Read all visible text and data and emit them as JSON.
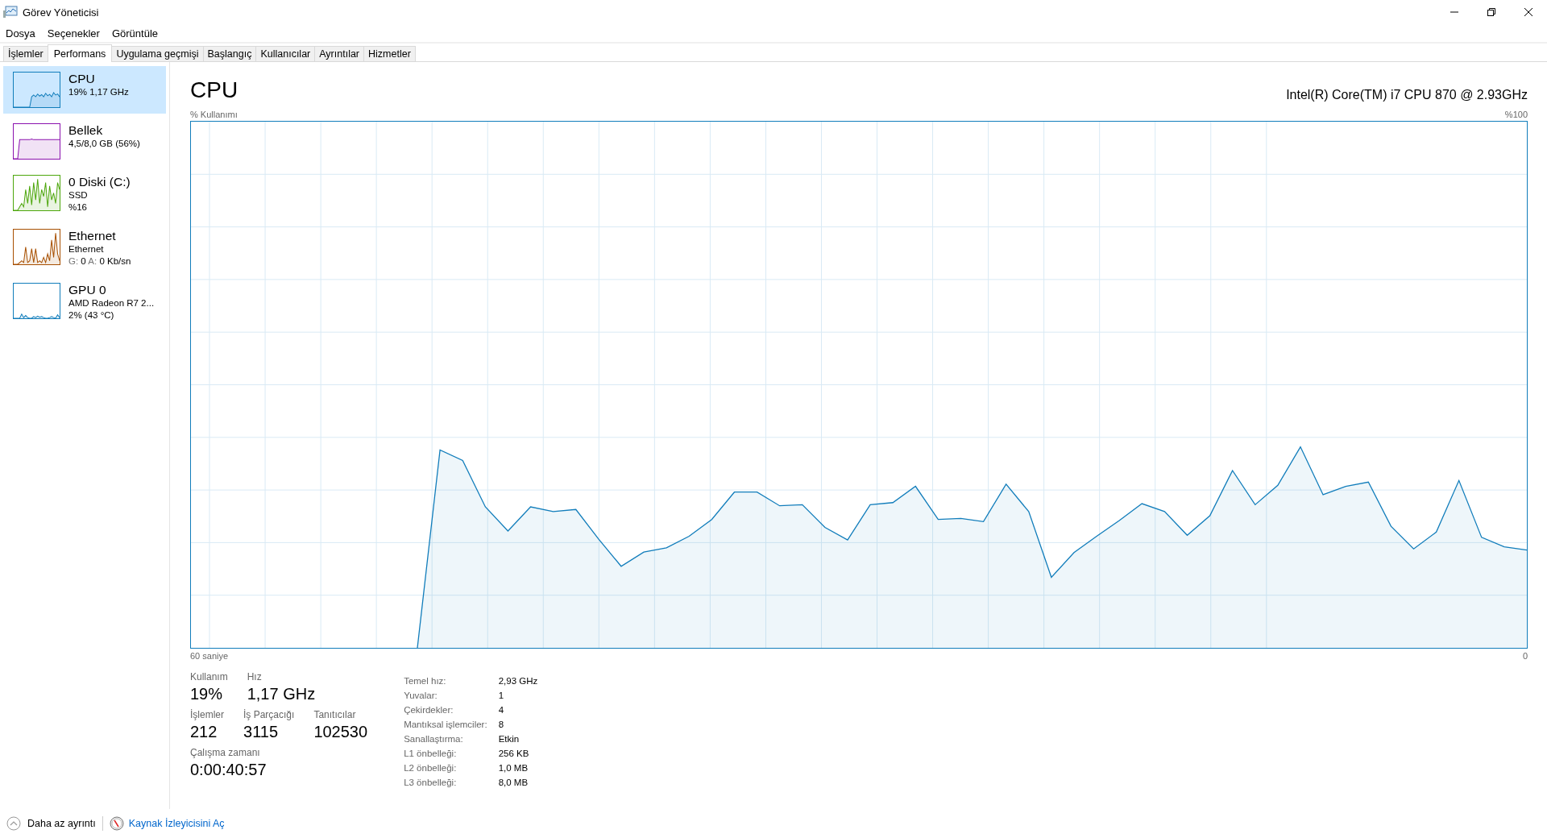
{
  "window": {
    "title": "Görev Yöneticisi"
  },
  "menu": [
    "Dosya",
    "Seçenekler",
    "Görüntüle"
  ],
  "tabs": [
    {
      "label": "İşlemler",
      "selected": false
    },
    {
      "label": "Performans",
      "selected": true
    },
    {
      "label": "Uygulama geçmişi",
      "selected": false
    },
    {
      "label": "Başlangıç",
      "selected": false
    },
    {
      "label": "Kullanıcılar",
      "selected": false
    },
    {
      "label": "Ayrıntılar",
      "selected": false
    },
    {
      "label": "Hizmetler",
      "selected": false
    }
  ],
  "sidebar": {
    "items": [
      {
        "name": "CPU",
        "lines": [
          "19% 1,17 GHz"
        ],
        "color": "#117dbb",
        "selected": true
      },
      {
        "name": "Bellek",
        "lines": [
          "4,5/8,0 GB (56%)"
        ],
        "color": "#8b12ae",
        "selected": false
      },
      {
        "name": "0 Diski (C:)",
        "lines": [
          "SSD",
          "%16"
        ],
        "color": "#4da60c",
        "selected": false
      },
      {
        "name": "Ethernet",
        "lines": [
          "Ethernet"
        ],
        "stats": [
          {
            "label": "G:",
            "value": "0"
          },
          {
            "label": "A:",
            "value": "0 Kb/sn"
          }
        ],
        "color": "#a74f01",
        "selected": false
      },
      {
        "name": "GPU 0",
        "lines": [
          "AMD Radeon R7 2...",
          "2% (43 °C)"
        ],
        "color": "#117dbb",
        "selected": false
      }
    ]
  },
  "panel": {
    "title": "CPU",
    "processor": "Intel(R) Core(TM) i7 CPU 870 @ 2.93GHz",
    "graph": {
      "caption": "% Kullanımı",
      "max_label": "%100",
      "time_label": "60 saniye",
      "end_label": "0"
    },
    "stats": [
      [
        {
          "label": "Kullanım",
          "value": "19%"
        },
        {
          "label": "Hız",
          "value": "1,17 GHz"
        }
      ],
      [
        {
          "label": "İşlemler",
          "value": "212"
        },
        {
          "label": "İş Parçacığı",
          "value": "3115"
        },
        {
          "label": "Tanıtıcılar",
          "value": "102530"
        }
      ],
      [
        {
          "label": "Çalışma zamanı",
          "value": "0:00:40:57"
        }
      ]
    ],
    "details": [
      {
        "label": "Temel hız:",
        "value": "2,93 GHz"
      },
      {
        "label": "Yuvalar:",
        "value": "1"
      },
      {
        "label": "Çekirdekler:",
        "value": "4"
      },
      {
        "label": "Mantıksal işlemciler:",
        "value": "8"
      },
      {
        "label": "Sanallaştırma:",
        "value": "Etkin"
      },
      {
        "label": "L1 önbelleği:",
        "value": "256 KB"
      },
      {
        "label": "L2 önbelleği:",
        "value": "1,0 MB"
      },
      {
        "label": "L3 önbelleği:",
        "value": "8,0 MB"
      }
    ]
  },
  "footer": {
    "collapse": "Daha az ayrıntı",
    "link": "Kaynak İzleyicisini Aç"
  }
}
